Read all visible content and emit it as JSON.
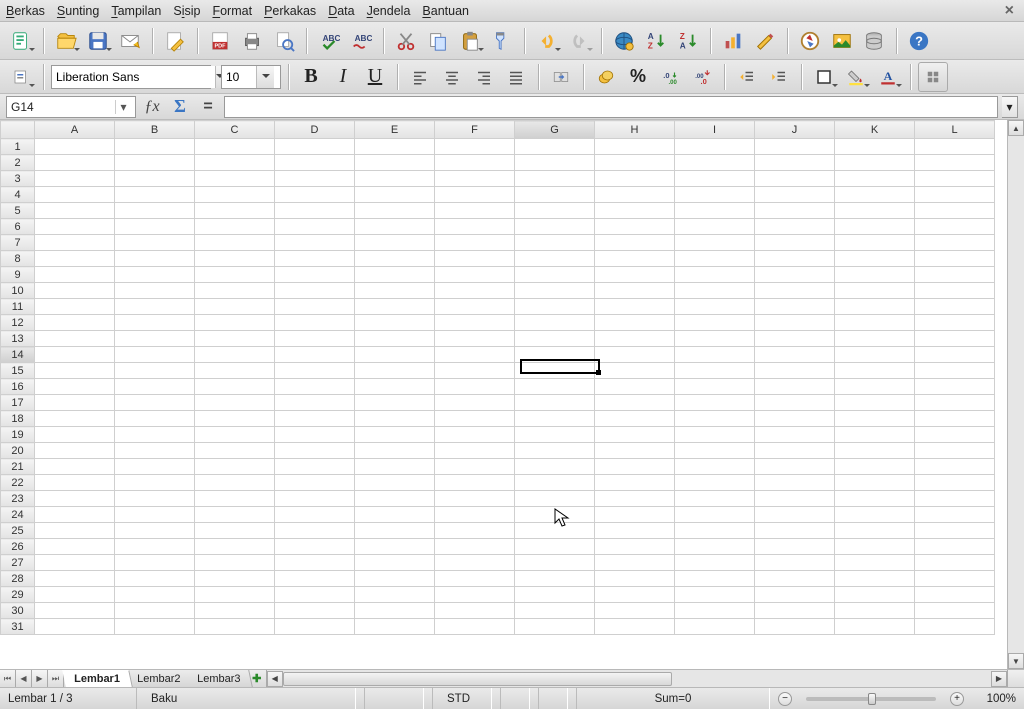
{
  "menu": {
    "items": [
      {
        "label": "Berkas",
        "u": "B"
      },
      {
        "label": "Sunting",
        "u": "S"
      },
      {
        "label": "Tampilan",
        "u": "T"
      },
      {
        "label": "Sisip",
        "u": "S"
      },
      {
        "label": "Format",
        "u": "F"
      },
      {
        "label": "Perkakas",
        "u": "P"
      },
      {
        "label": "Data",
        "u": "D"
      },
      {
        "label": "Jendela",
        "u": "J"
      },
      {
        "label": "Bantuan",
        "u": "B"
      }
    ]
  },
  "format_toolbar": {
    "font_name": "Liberation Sans",
    "font_size": "10"
  },
  "formula": {
    "cell_ref": "G14",
    "input": ""
  },
  "grid": {
    "columns": [
      "A",
      "B",
      "C",
      "D",
      "E",
      "F",
      "G",
      "H",
      "I",
      "J",
      "K",
      "L"
    ],
    "rows": 31,
    "active_col_index": 6,
    "active_row": 14
  },
  "tabs": {
    "sheets": [
      "Lembar1",
      "Lembar2",
      "Lembar3"
    ],
    "active": 0
  },
  "status": {
    "sheet_pos": "Lembar 1 / 3",
    "style": "Baku",
    "mode": "STD",
    "sum": "Sum=0",
    "zoom": "100%"
  },
  "icons": {
    "fx": "ƒx",
    "sigma": "Σ",
    "equals": "=",
    "percent": "%",
    "bold": "B",
    "italic": "I",
    "underline": "U"
  }
}
